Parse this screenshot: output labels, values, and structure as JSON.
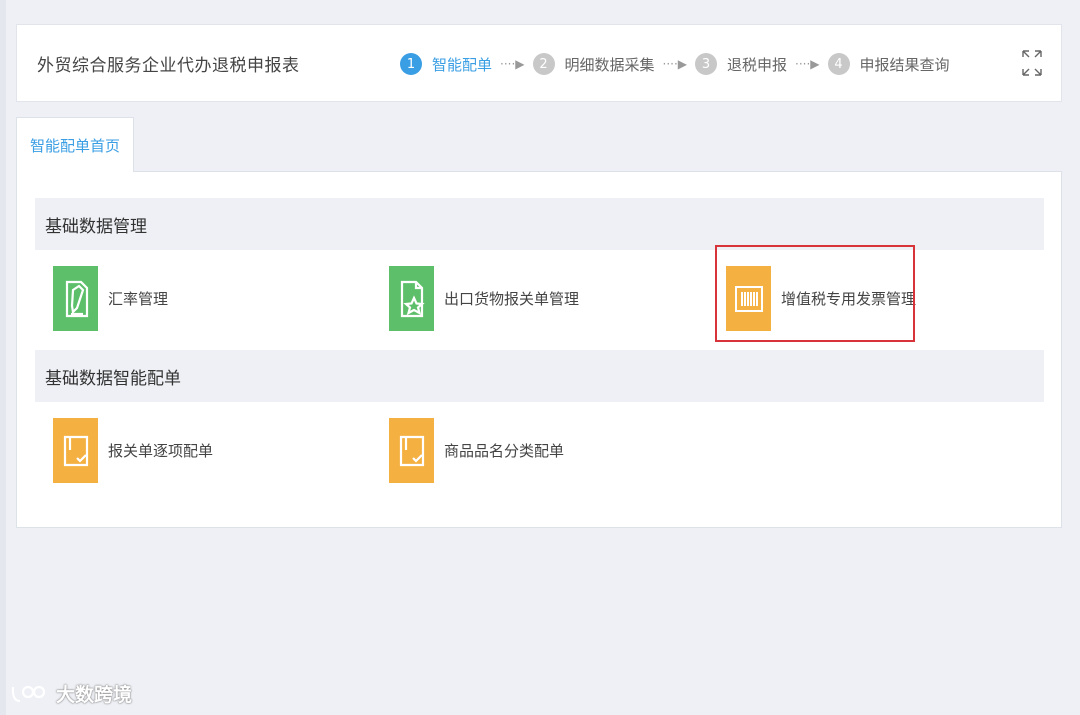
{
  "header": {
    "title": "外贸综合服务企业代办退税申报表",
    "steps": [
      {
        "num": "1",
        "label": "智能配单"
      },
      {
        "num": "2",
        "label": "明细数据采集"
      },
      {
        "num": "3",
        "label": "退税申报"
      },
      {
        "num": "4",
        "label": "申报结果查询"
      }
    ],
    "arrow": "····▶"
  },
  "tab": {
    "label": "智能配单首页"
  },
  "sections": [
    {
      "title": "基础数据管理",
      "tiles": [
        {
          "label": "汇率管理",
          "icon": "document-edit-icon",
          "color": "#5ebf6b"
        },
        {
          "label": "出口货物报关单管理",
          "icon": "document-star-icon",
          "color": "#5ebf6b"
        },
        {
          "label": "增值税专用发票管理",
          "icon": "barcode-icon",
          "color": "#f4b040"
        }
      ]
    },
    {
      "title": "基础数据智能配单",
      "tiles": [
        {
          "label": "报关单逐项配单",
          "icon": "box-check-icon",
          "color": "#f4b040"
        },
        {
          "label": "商品品名分类配单",
          "icon": "box-check-icon",
          "color": "#f4b040"
        }
      ]
    }
  ],
  "watermark": {
    "text": "大数跨境"
  },
  "colors": {
    "accent": "#3a9ee4",
    "green": "#5ebf6b",
    "orange": "#f4b040",
    "highlight": "#d8333a"
  }
}
